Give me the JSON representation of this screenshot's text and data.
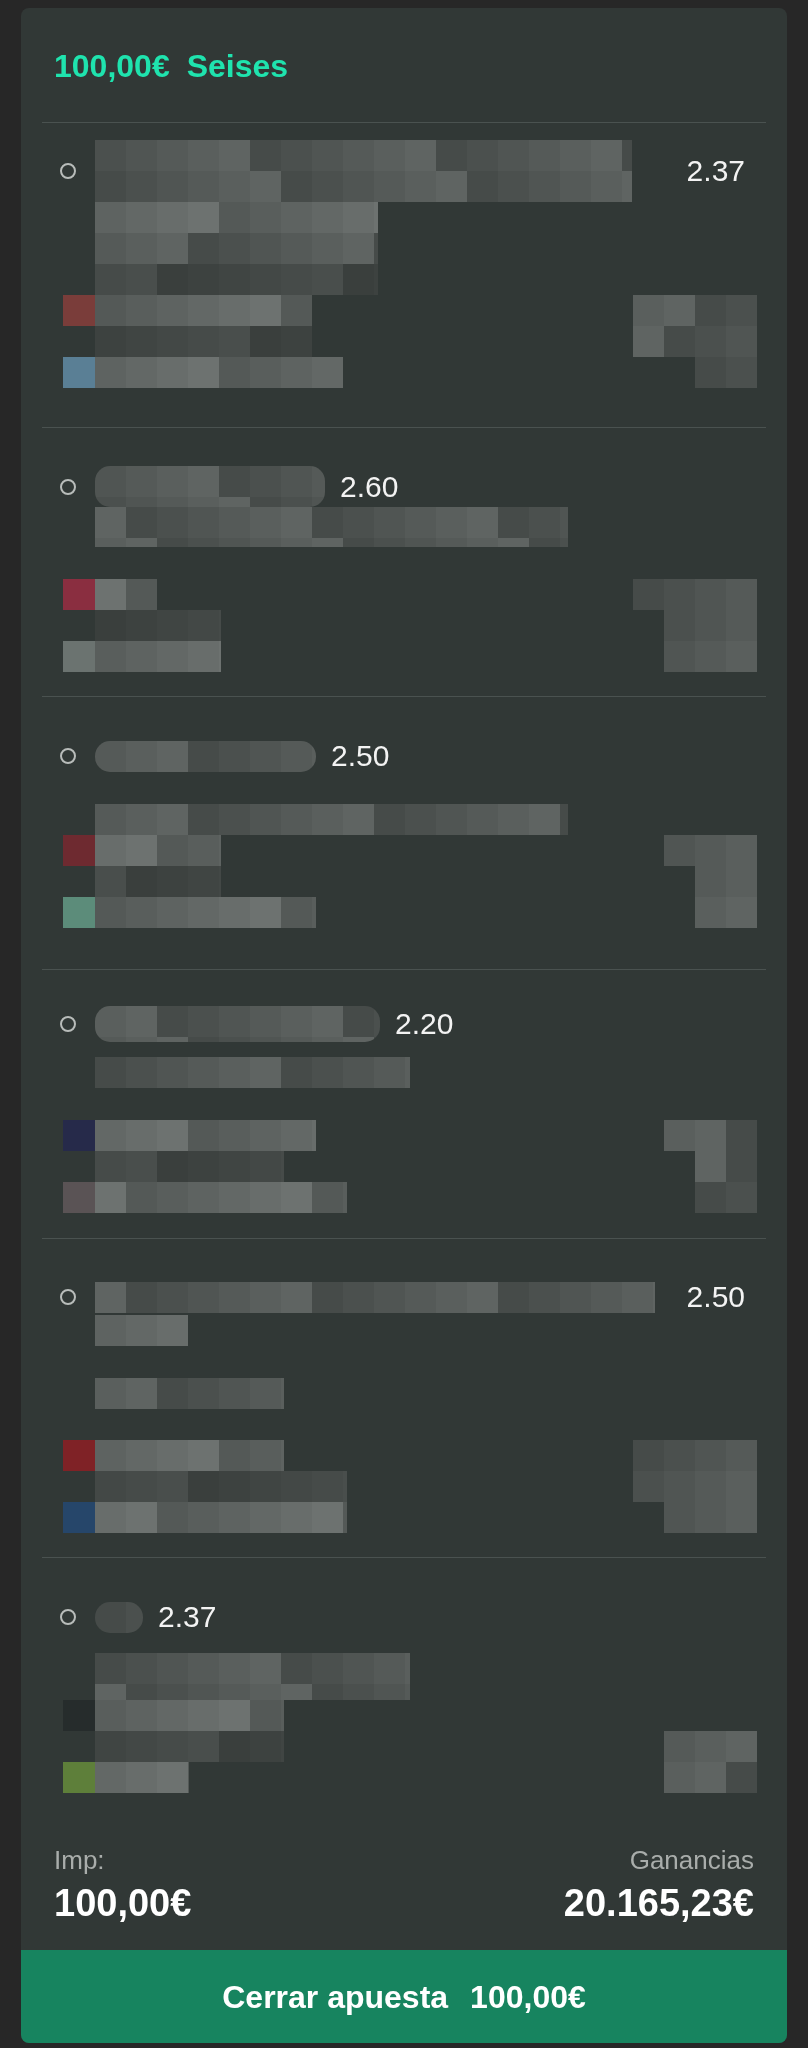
{
  "bet": {
    "stake": "100,00€",
    "type": "Seises"
  },
  "selections": [
    {
      "odds": "2.37",
      "teams": [
        {
          "color": "#7a3d3a"
        },
        {
          "color": "#5a7f95"
        }
      ]
    },
    {
      "odds": "2.60",
      "teams": [
        {
          "color": "#8a2e40"
        },
        {
          "color": "#6b7370"
        }
      ]
    },
    {
      "odds": "2.50",
      "teams": [
        {
          "color": "#6e2a30"
        },
        {
          "color": "#5c8c7a"
        }
      ]
    },
    {
      "odds": "2.20",
      "teams": [
        {
          "color": "#262a4a"
        },
        {
          "color": "#5a5355"
        }
      ]
    },
    {
      "odds": "2.50",
      "teams": [
        {
          "color": "#7f2226"
        },
        {
          "color": "#26466a"
        }
      ]
    },
    {
      "odds": "2.37",
      "teams": [
        {
          "color": "#262c2c"
        },
        {
          "color": "#5e7f3a"
        }
      ]
    }
  ],
  "summary": {
    "stake_label": "Imp:",
    "stake": "100,00€",
    "winnings_label": "Ganancias",
    "winnings": "20.165,23€"
  },
  "cashout_button": {
    "label": "Cerrar apuesta",
    "amount": "100,00€"
  }
}
